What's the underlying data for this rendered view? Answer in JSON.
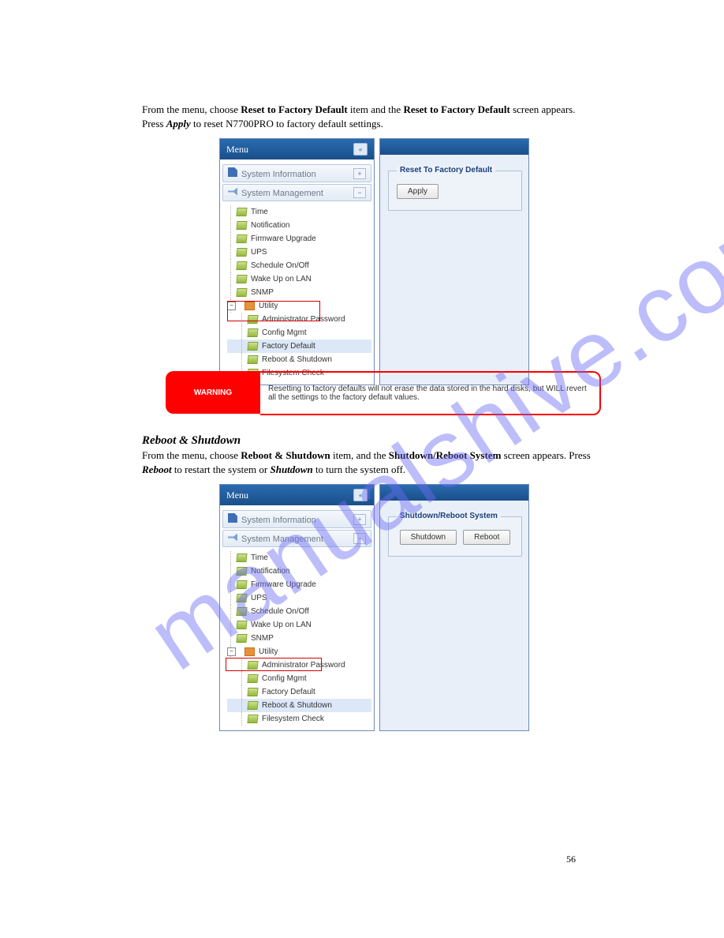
{
  "watermark": "manualshive.com",
  "section1": {
    "intro": "From the menu, choose Reset to Factory Default item and the Reset to Factory Default screen appears. Press Apply to reset N7700PRO to factory default settings.",
    "menu_title": "Menu",
    "acc": {
      "sysinfo": "System Information",
      "sysmgmt": "System Management"
    },
    "tree": {
      "time": "Time",
      "notif": "Notification",
      "fw": "Firmware Upgrade",
      "ups": "UPS",
      "sched": "Schedule On/Off",
      "wol": "Wake Up on LAN",
      "snmp": "SNMP",
      "util": "Utility",
      "admin": "Administrator Password",
      "cfg": "Config Mgmt",
      "factory": "Factory Default",
      "reboot": "Reboot & Shutdown",
      "fsck": "Filesystem Check"
    },
    "panel": {
      "title": "Reset To Factory Default",
      "apply": "Apply"
    }
  },
  "warning": {
    "label": "WARNING",
    "text": "Resetting to factory defaults will not erase the data stored in the hard disks, but WILL revert all the settings to the factory default values."
  },
  "section2": {
    "title": "Reboot & Shutdown",
    "intro": "From the menu, choose Reboot & Shutdown item, and the Shutdown/Reboot System screen appears. Press Reboot to restart the system or Shutdown to turn the system off.",
    "menu_title": "Menu",
    "acc": {
      "sysinfo": "System Information",
      "sysmgmt": "System Management"
    },
    "tree": {
      "time": "Time",
      "notif": "Notification",
      "fw": "Firmware Upgrade",
      "ups": "UPS",
      "sched": "Schedule On/Off",
      "wol": "Wake Up on LAN",
      "snmp": "SNMP",
      "util": "Utility",
      "admin": "Administrator Password",
      "cfg": "Config Mgmt",
      "factory": "Factory Default",
      "reboot": "Reboot & Shutdown",
      "fsck": "Filesystem Check"
    },
    "panel": {
      "title": "Shutdown/Reboot System",
      "shutdown": "Shutdown",
      "reboot": "Reboot"
    }
  },
  "page": "56"
}
